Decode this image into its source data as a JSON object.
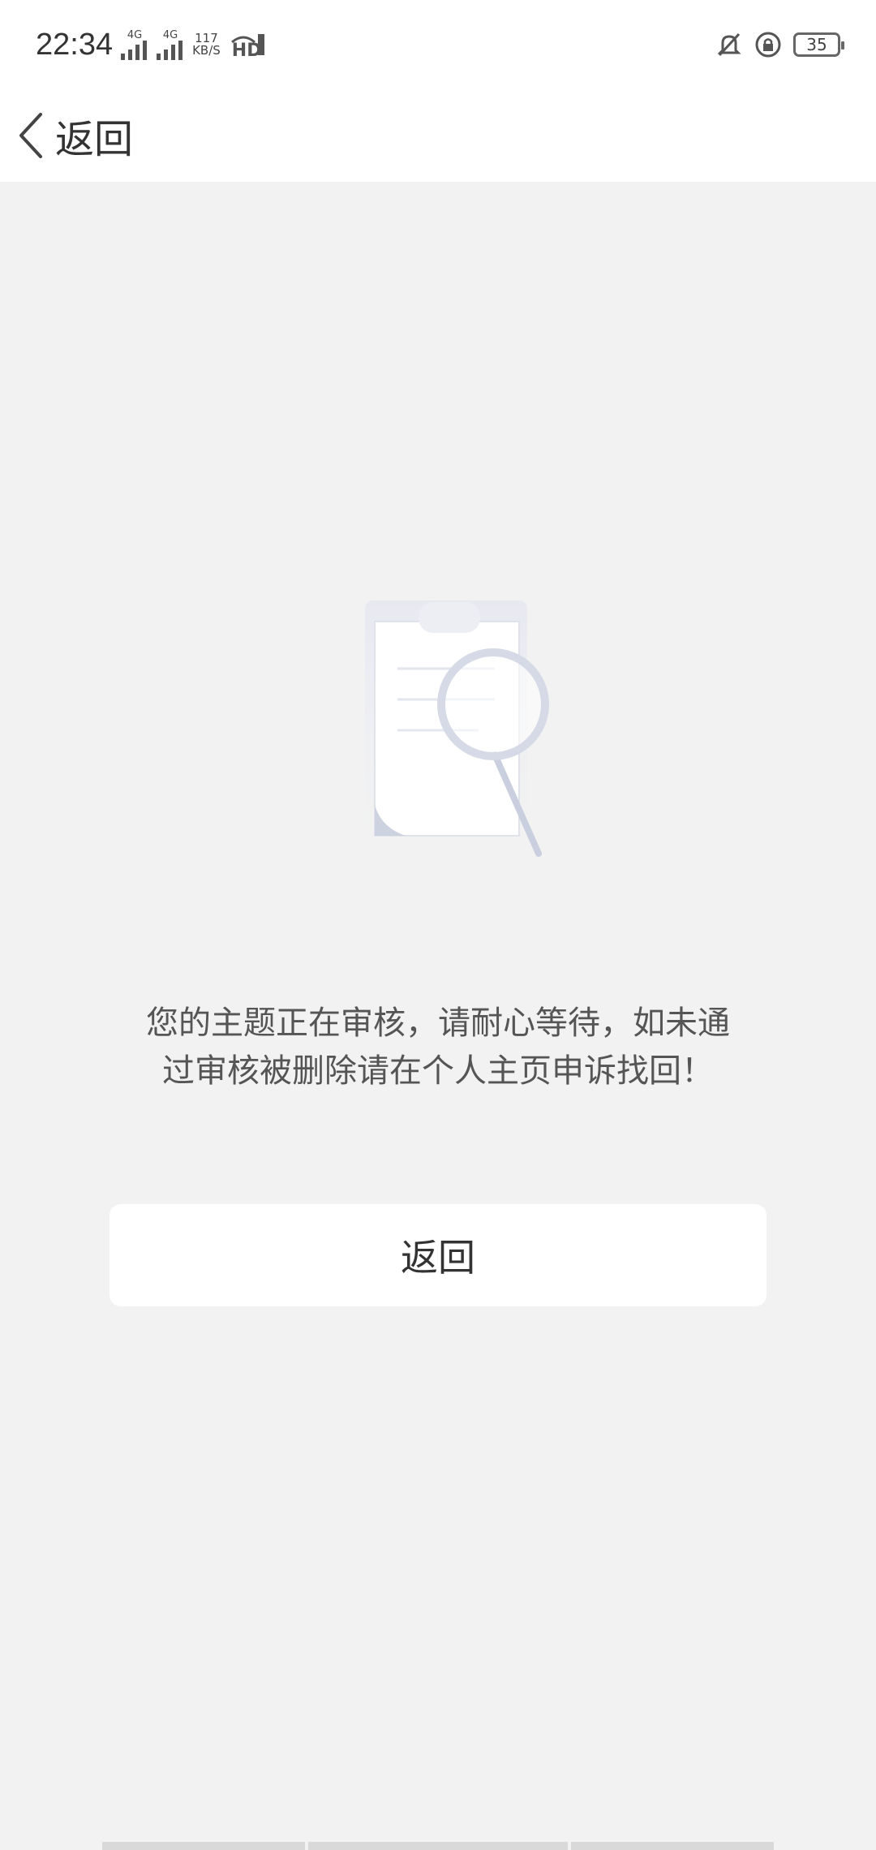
{
  "status_bar": {
    "time": "22:34",
    "signal_label_1": "4G",
    "signal_label_2": "4G",
    "net_speed_value": "117",
    "net_speed_unit": "KB/S",
    "hd_label": "HD",
    "battery_level": "35",
    "icons": [
      "signal-icon",
      "signal-icon",
      "hd-icon",
      "bell-off-icon",
      "lock-rotation-icon",
      "battery-icon"
    ]
  },
  "header": {
    "back_label": "返回",
    "icon": "chevron-left-icon"
  },
  "main": {
    "illustration_icon": "document-search-icon",
    "message": "您的主题正在审核，请耐心等待，如未通过审核被删除请在个人主页申诉找回！",
    "button_label": "返回"
  }
}
